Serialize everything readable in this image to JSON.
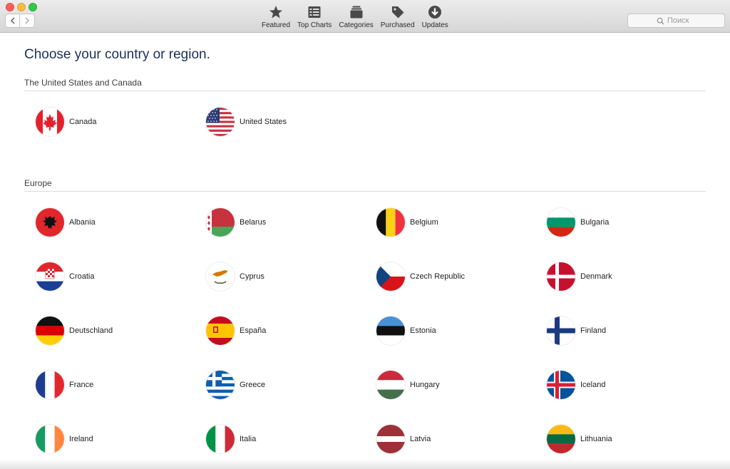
{
  "toolbar": {
    "tabs": [
      {
        "label": "Featured",
        "icon": "star-icon"
      },
      {
        "label": "Top Charts",
        "icon": "list-icon"
      },
      {
        "label": "Categories",
        "icon": "stack-icon"
      },
      {
        "label": "Purchased",
        "icon": "tag-icon"
      },
      {
        "label": "Updates",
        "icon": "download-arrow-icon"
      }
    ],
    "search_placeholder": "Поиск"
  },
  "main": {
    "title": "Choose your country or region.",
    "sections": [
      {
        "title": "The United States and Canada",
        "countries": [
          "Canada",
          "United States"
        ]
      },
      {
        "title": "Europe",
        "countries": [
          "Albania",
          "Belarus",
          "Belgium",
          "Bulgaria",
          "Croatia",
          "Cyprus",
          "Czech Republic",
          "Denmark",
          "Deutschland",
          "España",
          "Estonia",
          "Finland",
          "France",
          "Greece",
          "Hungary",
          "Iceland",
          "Ireland",
          "Italia",
          "Latvia",
          "Lithuania"
        ]
      }
    ]
  },
  "colors": {
    "title": "#1b2f5c",
    "close": "#fc605c",
    "minimize": "#fdbc40",
    "zoom": "#34c84a"
  }
}
